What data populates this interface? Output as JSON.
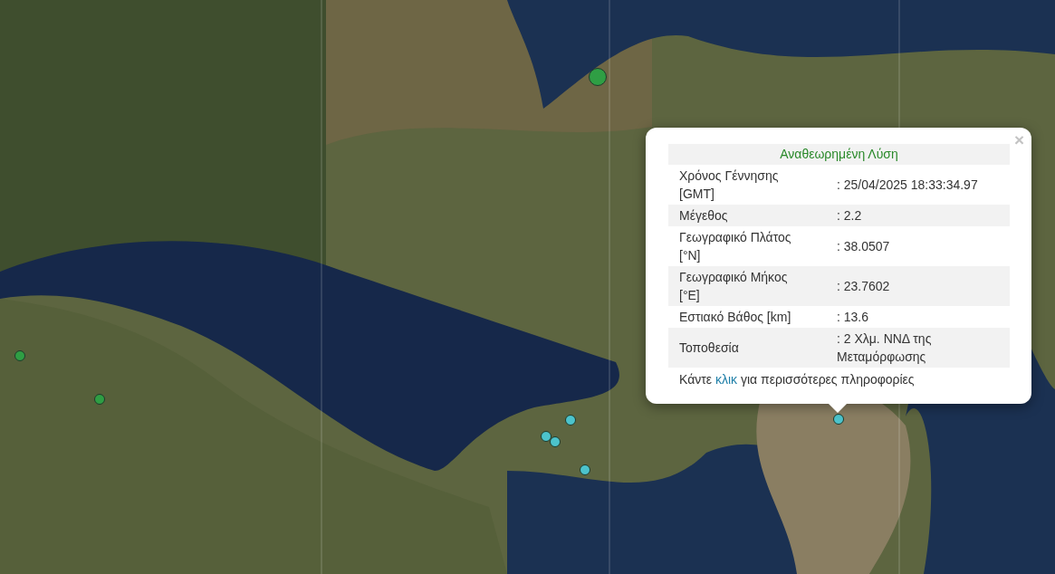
{
  "markers": [
    {
      "color": "#2f9e44",
      "kind": "large"
    },
    {
      "color": "#2f9e44",
      "kind": "small"
    },
    {
      "color": "#2f9e44",
      "kind": "small"
    },
    {
      "color": "#4cc3cc",
      "kind": "small"
    },
    {
      "color": "#4cc3cc",
      "kind": "small"
    },
    {
      "color": "#4cc3cc",
      "kind": "small"
    },
    {
      "color": "#4cc3cc",
      "kind": "small"
    },
    {
      "color": "#4cc3cc",
      "kind": "small"
    }
  ],
  "popup": {
    "close": "×",
    "title": "Αναθεωρημένη Λύση",
    "rows": [
      {
        "label": "Χρόνος Γέννησης [GMT]",
        "value": ": 25/04/2025 18:33:34.97"
      },
      {
        "label": "Μέγεθος",
        "value": ": 2.2"
      },
      {
        "label": "Γεωγραφικό Πλάτος [°N]",
        "value": ": 38.0507"
      },
      {
        "label": "Γεωγραφικό Μήκος [°E]",
        "value": ": 23.7602"
      },
      {
        "label": "Εστιακό Βάθος [km]",
        "value": ": 13.6"
      },
      {
        "label": "Τοποθεσία",
        "value": ": 2 Χλμ. ΝΝΔ της Μεταμόρφωσης"
      }
    ],
    "footer": {
      "before": "Κάντε ",
      "link": "κλικ",
      "after": " για περισσότερες πληροφορίες"
    }
  }
}
